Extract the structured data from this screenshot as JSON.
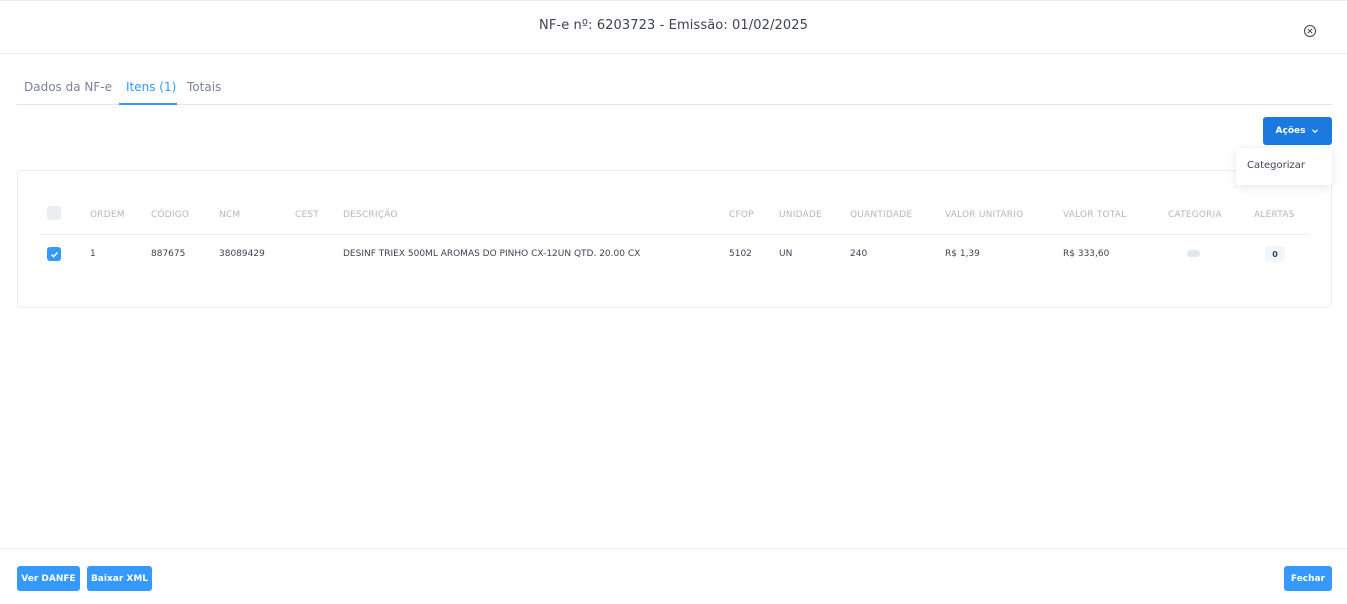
{
  "modal": {
    "title": "NF-e nº: 6203723 - Emissão: 01/02/2025",
    "close_icon": "close-circle-icon"
  },
  "tabs": [
    {
      "label": "Dados da NF-e",
      "active": false
    },
    {
      "label": "Itens (1)",
      "active": true
    },
    {
      "label": "Totais",
      "active": false
    }
  ],
  "actions": {
    "button_label": "Ações",
    "button_icon": "chevron-down-icon",
    "dropdown_items": [
      "Categorizar"
    ]
  },
  "table": {
    "headers": [
      "ORDEM",
      "CÓDIGO",
      "NCM",
      "CEST",
      "DESCRIÇÃO",
      "CFOP",
      "UNIDADE",
      "QUANTIDADE",
      "VALOR UNITÁRIO",
      "VALOR TOTAL",
      "CATEGORIA",
      "ALERTAS"
    ],
    "rows": [
      {
        "checked": true,
        "ordem": "1",
        "codigo": "887675",
        "ncm": "38089429",
        "cest": "",
        "descricao": "DESINF TRIEX 500ML AROMAS DO PINHO CX-12UN QTD. 20.00 CX",
        "cfop": "5102",
        "unidade": "UN",
        "quantidade": "240",
        "valor_unitario": "R$ 1,39",
        "valor_total": "R$ 333,60",
        "categoria": "",
        "alertas": "0"
      }
    ]
  },
  "footer": {
    "ver_danfe": "Ver DANFE",
    "baixar_xml": "Baixar XML",
    "fechar": "Fechar"
  },
  "colors": {
    "primary": "#3699ff",
    "primary_dark": "#1b7ae0",
    "muted_text": "#b5b5c3",
    "text": "#3f4254"
  }
}
